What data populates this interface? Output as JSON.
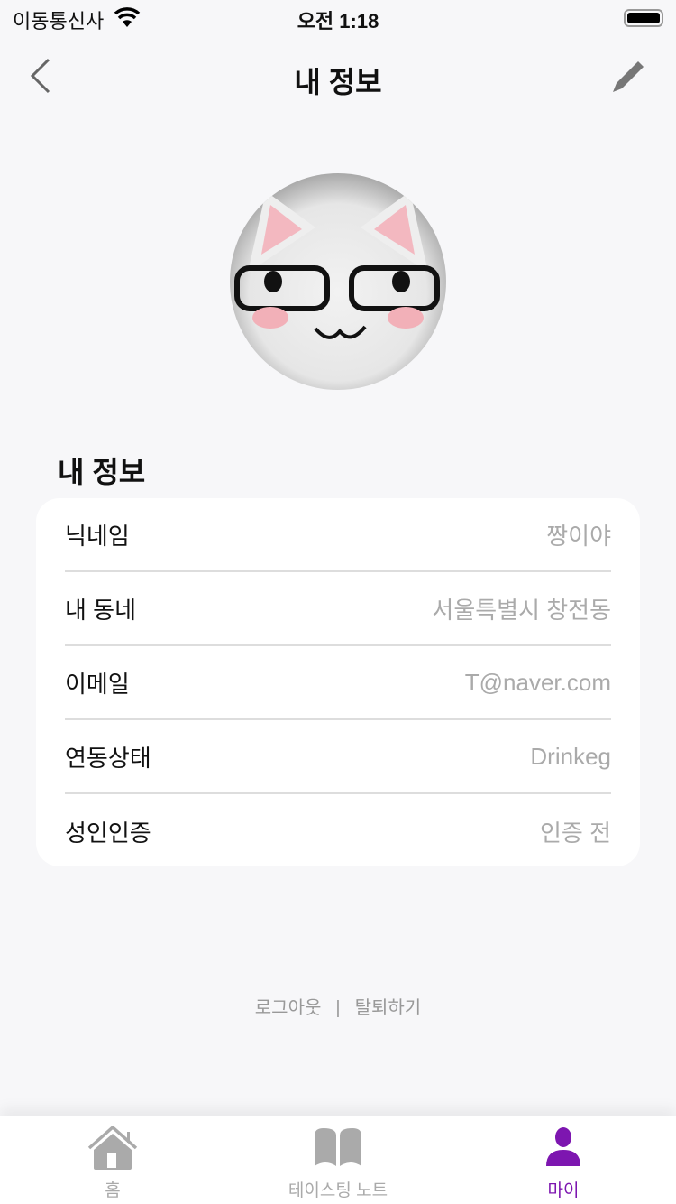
{
  "status": {
    "carrier": "이동통신사",
    "time": "오전 1:18"
  },
  "nav": {
    "title": "내 정보"
  },
  "section": {
    "title": "내 정보"
  },
  "info": [
    {
      "label": "닉네임",
      "value": "짱이야"
    },
    {
      "label": "내 동네",
      "value": "서울특별시 창전동"
    },
    {
      "label": "이메일",
      "value": "T@naver.com"
    },
    {
      "label": "연동상태",
      "value": "Drinkeg"
    },
    {
      "label": "성인인증",
      "value": "인증 전"
    }
  ],
  "footer": {
    "logout": "로그아웃",
    "separator": "|",
    "withdraw": "탈퇴하기"
  },
  "tabs": [
    {
      "label": "홈",
      "icon": "home-icon"
    },
    {
      "label": "테이스팅 노트",
      "icon": "book-icon"
    },
    {
      "label": "마이",
      "icon": "person-icon",
      "active": true
    }
  ],
  "colors": {
    "accent": "#7d16b0",
    "inactive": "#aaaaaa"
  }
}
